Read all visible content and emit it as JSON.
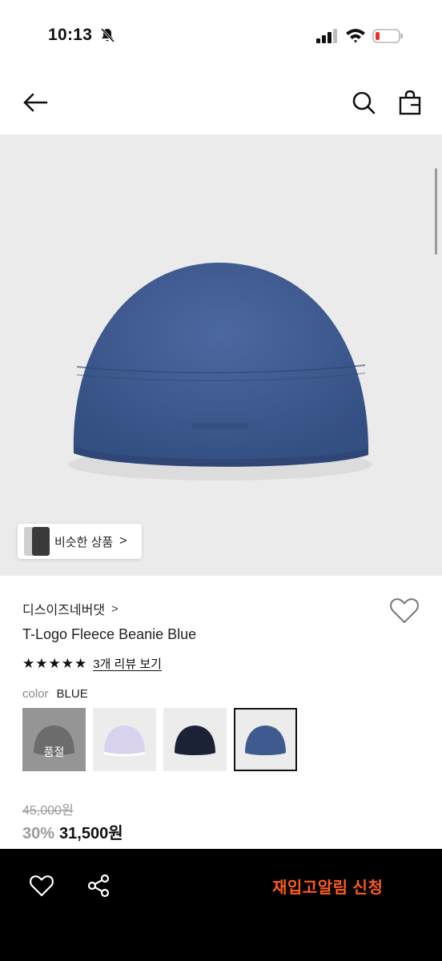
{
  "status_bar": {
    "time": "10:13",
    "icons": [
      "bell-slash-icon",
      "signal-icon",
      "wifi-icon",
      "battery-low-icon"
    ],
    "battery_color": "#e5322d"
  },
  "nav": {
    "icons": [
      "back-arrow-icon",
      "search-icon",
      "shopping-bag-icon"
    ]
  },
  "gallery": {
    "similar_button_label": "비슷한 상품",
    "similar_button_chevron": ">"
  },
  "product": {
    "brand": "디스이즈네버댓",
    "brand_chevron": ">",
    "name": "T-Logo Fleece Beanie Blue",
    "rating_stars": 5,
    "review_link": "3개 리뷰 보기",
    "color_label": "color",
    "color_value": "BLUE",
    "swatches": [
      {
        "name": "gray",
        "color": "#4a4a4a",
        "sold_out_label": "품절"
      },
      {
        "name": "lavender",
        "color": "#d9d2ee"
      },
      {
        "name": "navy",
        "color": "#1b2236"
      },
      {
        "name": "blue",
        "color": "#3f5a8e",
        "selected": true
      }
    ],
    "original_price": "45,000원",
    "discount": "30%",
    "sale_price": "31,500원"
  },
  "bottom_bar": {
    "icons": [
      "heart-icon",
      "share-icon"
    ],
    "restock_button": "재입고알림 신청",
    "accent_color": "#ff5a1f"
  }
}
